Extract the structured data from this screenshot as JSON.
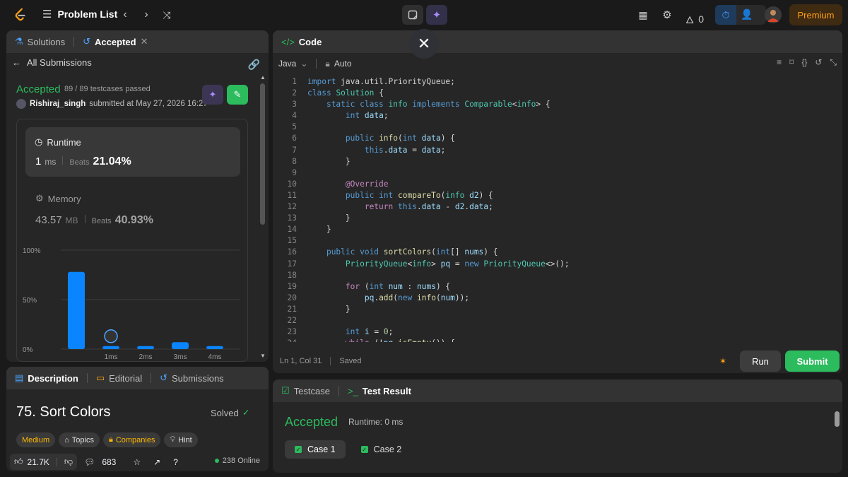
{
  "topbar": {
    "title": "Problem List",
    "streak": "0",
    "premium": "Premium"
  },
  "submission": {
    "tabs": [
      {
        "label": "Solutions"
      },
      {
        "label": "Accepted"
      }
    ],
    "all_submissions": "All Submissions",
    "status": "Accepted",
    "testcases": "89 / 89 testcases passed",
    "user": "Rishiraj_singh",
    "submitted": "submitted at May 27, 2026 16:27",
    "runtime": {
      "label": "Runtime",
      "value": "1",
      "unit": "ms",
      "beats_label": "Beats",
      "beats": "21.04%"
    },
    "memory": {
      "label": "Memory",
      "value": "43.57",
      "unit": "MB",
      "beats_label": "Beats",
      "beats": "40.93%"
    }
  },
  "chart_data": {
    "type": "bar",
    "categories": [
      "",
      "1ms",
      "2ms",
      "3ms",
      "4ms"
    ],
    "values": [
      78,
      3,
      3,
      7,
      3
    ],
    "y_ticks": [
      "100%",
      "50%",
      "0%"
    ],
    "ylim": [
      0,
      100
    ],
    "highlight_index": 1,
    "colors": {
      "bar": "#0a84ff",
      "grid": "#3e3e3e"
    }
  },
  "description": {
    "tabs": [
      {
        "label": "Description"
      },
      {
        "label": "Editorial"
      },
      {
        "label": "Submissions"
      }
    ],
    "title": "75. Sort Colors",
    "solved": "Solved",
    "tags": [
      "Medium",
      "Topics",
      "Companies",
      "Hint"
    ],
    "likes": "21.7K",
    "comments": "683",
    "online": "238 Online"
  },
  "code": {
    "header": "Code",
    "language": "Java",
    "mode": "Auto",
    "cursor": "Ln 1, Col 31",
    "saved": "Saved",
    "run": "Run",
    "submit": "Submit"
  },
  "result": {
    "tabs": [
      {
        "label": "Testcase"
      },
      {
        "label": "Test Result"
      }
    ],
    "status": "Accepted",
    "runtime": "Runtime: 0 ms",
    "cases": [
      "Case 1",
      "Case 2"
    ]
  },
  "colors": {
    "accepted": "#2cbb5d",
    "accent": "#ffa116",
    "bar": "#0a84ff"
  }
}
